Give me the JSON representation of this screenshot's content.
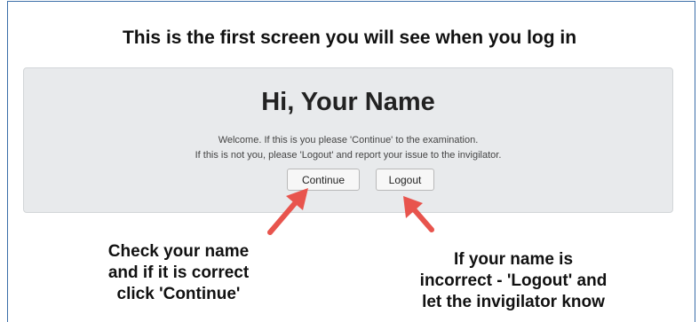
{
  "headline": "This is the first screen you will see when you log in",
  "panel": {
    "greeting": "Hi, Your Name",
    "message_line1": "Welcome. If this is you please 'Continue' to the examination.",
    "message_line2": "If this is not you, please 'Logout' and report your issue to the invigilator.",
    "continue_label": "Continue",
    "logout_label": "Logout"
  },
  "annotations": {
    "left": [
      "Check your name",
      "and if it is correct",
      "click 'Continue'"
    ],
    "right": [
      "If your name is",
      "incorrect - 'Logout' and",
      "let the invigilator know"
    ]
  },
  "colors": {
    "frame_border": "#3b6ea8",
    "panel_bg": "#e8eaec",
    "arrow": "#e8544d"
  }
}
